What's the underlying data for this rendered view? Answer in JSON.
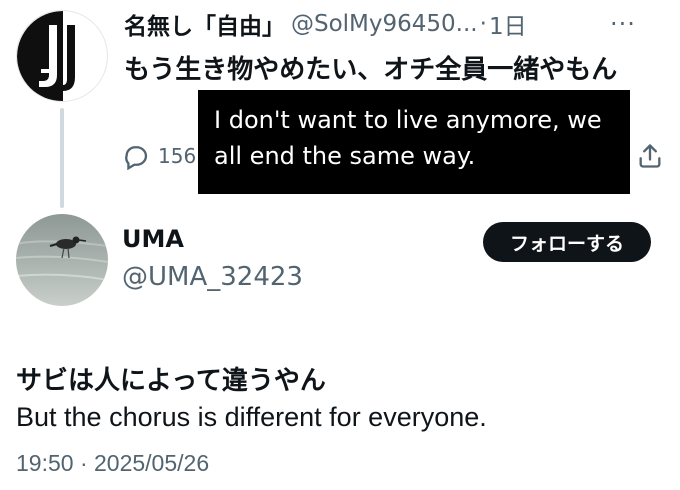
{
  "parent_tweet": {
    "display_name": "名無し「自由」",
    "handle": "@SolMy96450...",
    "separator": "·",
    "time": "1日",
    "more_label": "···",
    "text": "もう生き物やめたい、オチ全員一緒やもん",
    "reply_count": "156",
    "avatar_letter": "J"
  },
  "translation_overlay": {
    "text": "I don't want to live anymore, we all end the same way."
  },
  "reply_tweet": {
    "display_name": "UMA",
    "handle": "@UMA_32423",
    "follow_label": "フォローする",
    "text_jp": "サビは人によって違うやん",
    "text_en": "But the chorus is different for everyone.",
    "timestamp": "19:50 · 2025/05/26"
  },
  "colors": {
    "text_primary": "#0f1419",
    "text_secondary": "#536471",
    "button_bg": "#0f1419",
    "thread_line": "#cfd9de",
    "overlay_bg": "#000000"
  }
}
